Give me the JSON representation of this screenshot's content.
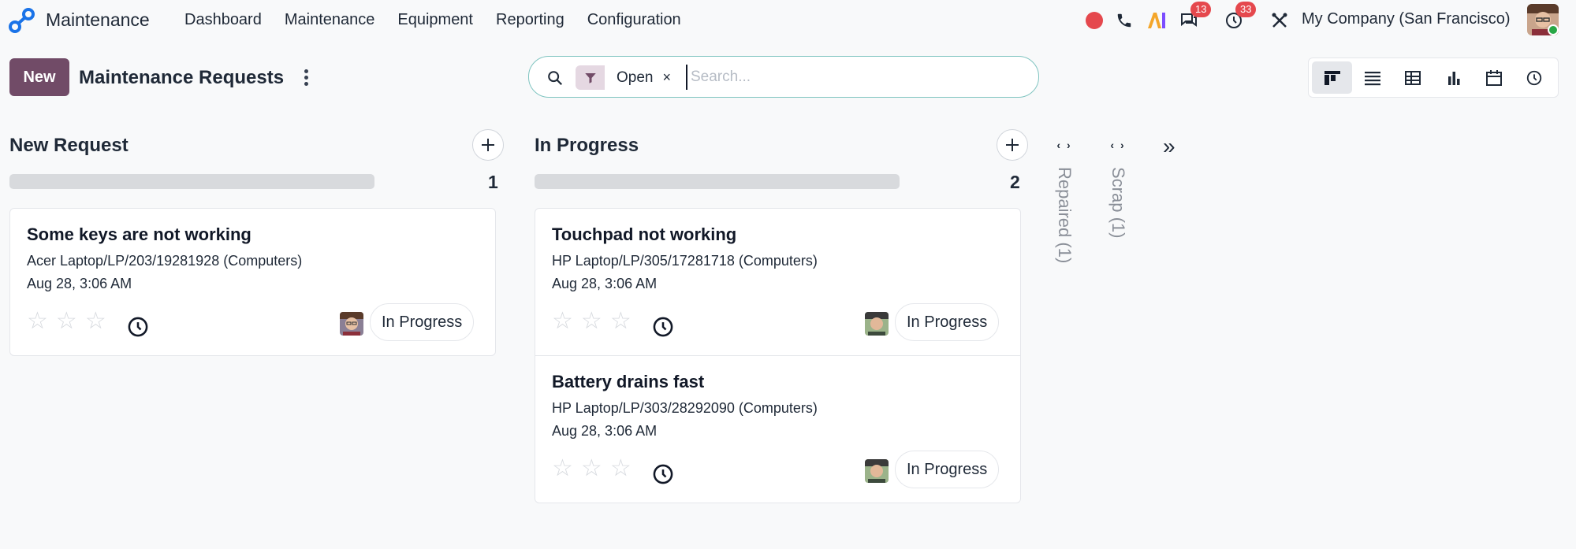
{
  "navbar": {
    "app_name": "Maintenance",
    "menu": [
      "Dashboard",
      "Maintenance",
      "Equipment",
      "Reporting",
      "Configuration"
    ],
    "messages_badge": "13",
    "activities_badge": "33",
    "company": "My Company (San Francisco)"
  },
  "control_panel": {
    "new_label": "New",
    "title": "Maintenance Requests",
    "facet_label": "Open",
    "facet_remove": "×",
    "search_placeholder": "Search...",
    "views": [
      "kanban",
      "list",
      "pivot",
      "graph",
      "calendar",
      "activity"
    ]
  },
  "columns": [
    {
      "title": "New Request",
      "count": "1",
      "add_label": "+",
      "cards": [
        {
          "title": "Some keys are not working",
          "equipment": "Acer Laptop/LP/203/19281928 (Computers)",
          "date": "Aug 28, 3:06 AM",
          "status": "In Progress"
        }
      ]
    },
    {
      "title": "In Progress",
      "count": "2",
      "add_label": "+",
      "cards": [
        {
          "title": "Touchpad not working",
          "equipment": "HP Laptop/LP/305/17281718 (Computers)",
          "date": "Aug 28, 3:06 AM",
          "status": "In Progress"
        },
        {
          "title": "Battery drains fast",
          "equipment": "HP Laptop/LP/303/28292090 (Computers)",
          "date": "Aug 28, 3:06 AM",
          "status": "In Progress"
        }
      ]
    }
  ],
  "folded_columns": [
    {
      "label": "Repaired (1)"
    },
    {
      "label": "Scrap (1)"
    }
  ],
  "fold_arrow": "‹ ›",
  "expand_label": "»",
  "colors": {
    "brand": "#714b67",
    "badge": "#e5484d",
    "record_dot": "#e5484d"
  }
}
